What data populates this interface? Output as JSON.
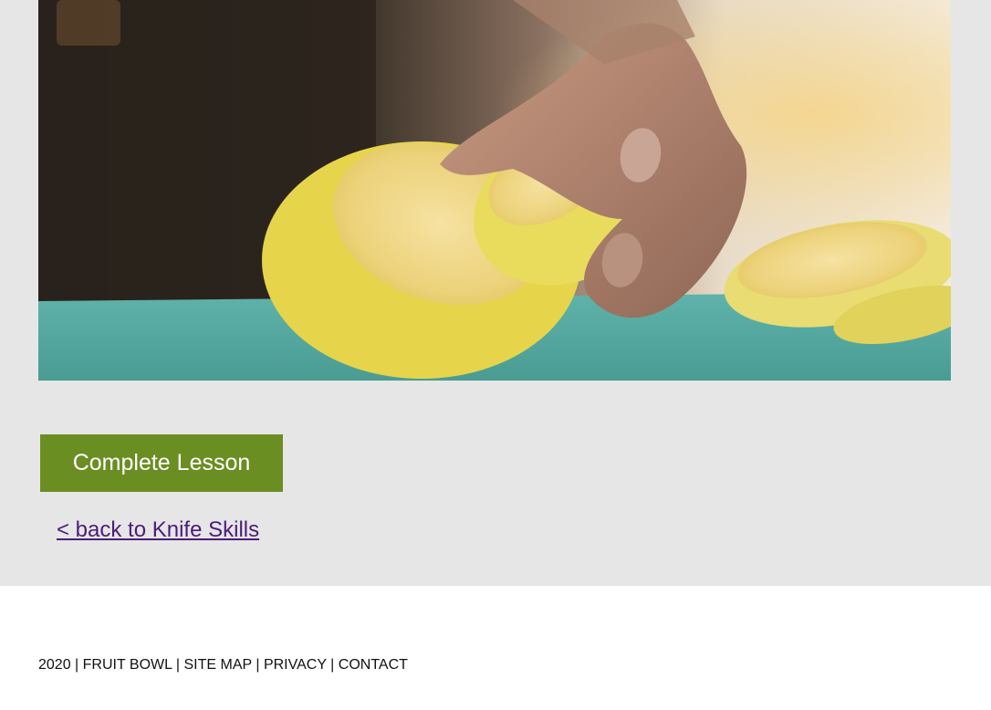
{
  "hero": {
    "image_alt": "Hand slicing lemons on a cutting board"
  },
  "lesson": {
    "complete_label": "Complete Lesson",
    "back_link_label": "< back to Knife Skills"
  },
  "footer": {
    "year": "2020",
    "separator": "|",
    "links": [
      "FRUIT BOWL",
      "SITE MAP",
      "PRIVACY",
      "CONTACT"
    ]
  },
  "colors": {
    "background": "#e6e6e6",
    "button": "#6b8e23",
    "link": "#4b1d7a"
  }
}
